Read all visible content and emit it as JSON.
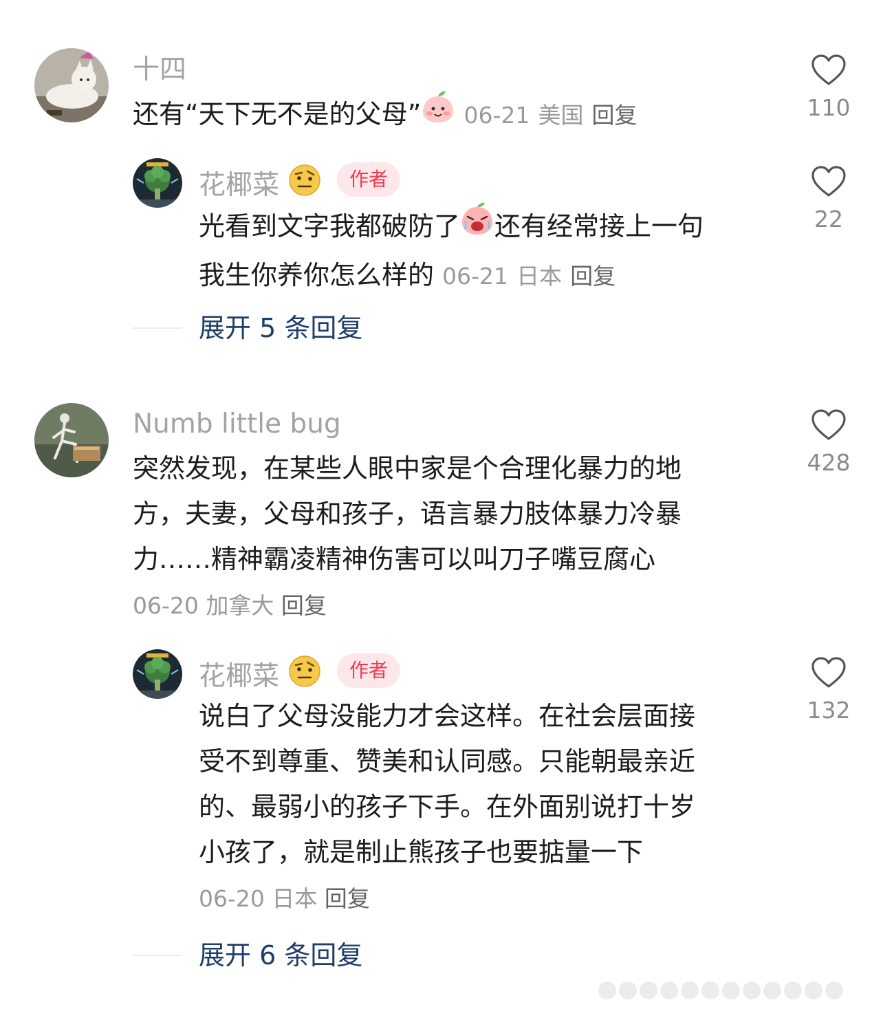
{
  "comments": [
    {
      "username": "十四",
      "text_lines": [
        "还有“天下无不是的父母”"
      ],
      "date": "06-21",
      "location": "美国",
      "reply_label": "回复",
      "likes": "110",
      "emoji": "peach-smile",
      "replies": [
        {
          "username": "花椰菜",
          "badge": "作者",
          "text_lines": [
            "光看到文字我都破防了",
            "还有经常接上一句",
            "我生你养你怎么样的"
          ],
          "date": "06-21",
          "location": "日本",
          "reply_label": "回复",
          "likes": "22",
          "emoji": "peach-crying"
        }
      ],
      "expand_label": "展开 5 条回复"
    },
    {
      "username": "Numb little bug",
      "text_lines": [
        "突然发现，在某些人眼中家是个合理化暴力的地",
        "方，夫妻，父母和孩子，语言暴力肢体暴力冷暴",
        "力……精神霸凌精神伤害可以叫刀子嘴豆腐心"
      ],
      "date": "06-20",
      "location": "加拿大",
      "reply_label": "回复",
      "likes": "428",
      "replies": [
        {
          "username": "花椰菜",
          "badge": "作者",
          "text_lines": [
            "说白了父母没能力才会这样。在社会层面接",
            "受不到尊重、赞美和认同感。只能朝最亲近",
            "的、最弱小的孩子下手。在外面别说打十岁",
            "小孩了，就是制止熊孩子也要掂量一下"
          ],
          "date": "06-20",
          "location": "日本",
          "reply_label": "回复",
          "likes": "132"
        }
      ],
      "expand_label": "展开 6 条回复"
    }
  ],
  "icons": {
    "like": "heart-outline-icon"
  },
  "colors": {
    "author_badge_bg": "#fde7ea",
    "author_badge_text": "#f0394e",
    "expand_link": "#1f3d6b"
  }
}
